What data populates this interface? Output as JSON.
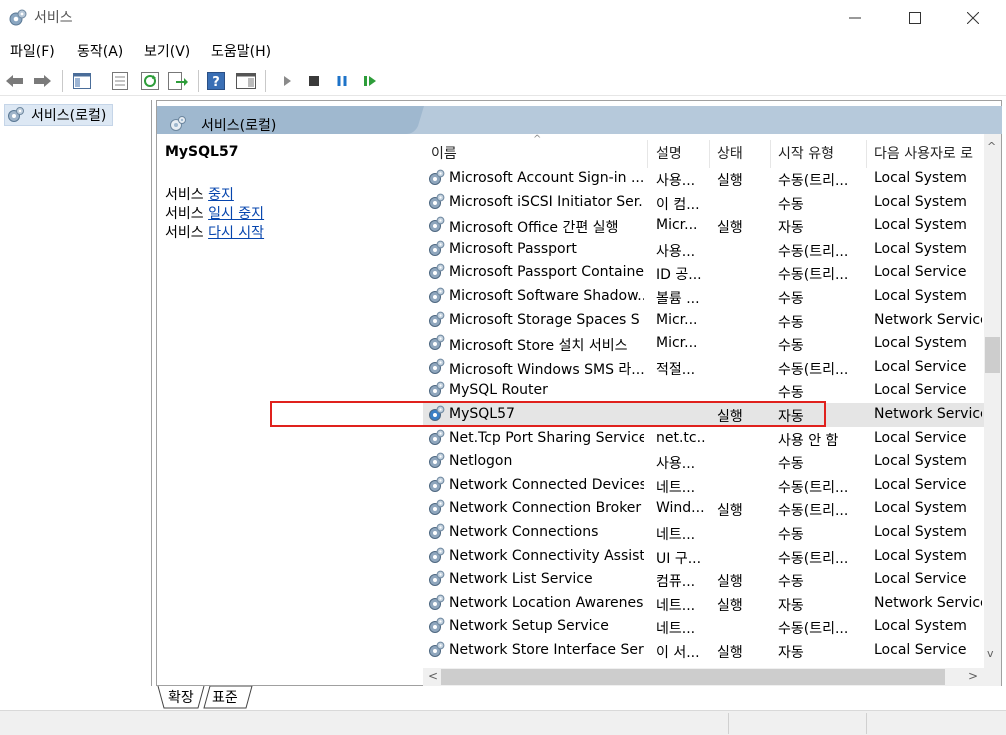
{
  "window": {
    "title": "서비스",
    "icon": "gear-icon"
  },
  "menu": [
    "파일(F)",
    "동작(A)",
    "보기(V)",
    "도움말(H)"
  ],
  "toolbar_icons": [
    "back-arrow-icon",
    "forward-arrow-icon",
    "show-hide-console-tree-icon",
    "properties-icon",
    "refresh-icon",
    "export-list-icon",
    "help-icon",
    "show-hide-action-pane-icon",
    "start-service-icon",
    "stop-service-icon",
    "pause-service-icon",
    "restart-service-icon"
  ],
  "tree": {
    "root_label": "서비스(로컬)"
  },
  "panel": {
    "header_title": "서비스(로컬)",
    "selected_name": "MySQL57",
    "action_prefix": "서비스",
    "actions": [
      "중지",
      "일시 중지",
      "다시 시작"
    ]
  },
  "columns": [
    "이름",
    "설명",
    "상태",
    "시작 유형",
    "다음 사용자로 로"
  ],
  "services": [
    {
      "name": "Microsoft Account Sign-in ...",
      "desc": "사용...",
      "status": "실행",
      "startup": "수동(트리...",
      "logon": "Local System"
    },
    {
      "name": "Microsoft iSCSI Initiator Ser...",
      "desc": "이 컴...",
      "status": "",
      "startup": "수동",
      "logon": "Local System"
    },
    {
      "name": "Microsoft Office 간편 실행",
      "desc": "Micr...",
      "status": "실행",
      "startup": "자동",
      "logon": "Local System"
    },
    {
      "name": "Microsoft Passport",
      "desc": "사용...",
      "status": "",
      "startup": "수동(트리...",
      "logon": "Local System"
    },
    {
      "name": "Microsoft Passport Container",
      "desc": "ID 공...",
      "status": "",
      "startup": "수동(트리...",
      "logon": "Local Service"
    },
    {
      "name": "Microsoft Software Shadow...",
      "desc": "볼륨 ...",
      "status": "",
      "startup": "수동",
      "logon": "Local System"
    },
    {
      "name": "Microsoft Storage Spaces S",
      "desc": "Micr...",
      "status": "",
      "startup": "수동",
      "logon": "Network Service"
    },
    {
      "name": "Microsoft Store 설치 서비스",
      "desc": "Micr...",
      "status": "",
      "startup": "수동",
      "logon": "Local System"
    },
    {
      "name": "Microsoft Windows SMS 라...",
      "desc": "적절...",
      "status": "",
      "startup": "수동(트리...",
      "logon": "Local Service"
    },
    {
      "name": "MySQL Router",
      "desc": "",
      "status": "",
      "startup": "수동",
      "logon": "Local Service"
    },
    {
      "name": "MySQL57",
      "desc": "",
      "status": "실행",
      "startup": "자동",
      "logon": "Network Service",
      "selected": true
    },
    {
      "name": "Net.Tcp Port Sharing Service",
      "desc": "net.tc...",
      "status": "",
      "startup": "사용 안 함",
      "logon": "Local Service"
    },
    {
      "name": "Netlogon",
      "desc": "사용...",
      "status": "",
      "startup": "수동",
      "logon": "Local System"
    },
    {
      "name": "Network Connected Devices...",
      "desc": "네트...",
      "status": "",
      "startup": "수동(트리...",
      "logon": "Local Service"
    },
    {
      "name": "Network Connection Broker",
      "desc": "Wind...",
      "status": "실행",
      "startup": "수동(트리...",
      "logon": "Local System"
    },
    {
      "name": "Network Connections",
      "desc": "네트...",
      "status": "",
      "startup": "수동",
      "logon": "Local System"
    },
    {
      "name": "Network Connectivity Assist",
      "desc": "UI 구...",
      "status": "",
      "startup": "수동(트리...",
      "logon": "Local System"
    },
    {
      "name": "Network List Service",
      "desc": "컴퓨...",
      "status": "실행",
      "startup": "수동",
      "logon": "Local Service"
    },
    {
      "name": "Network Location Awareness",
      "desc": "네트...",
      "status": "실행",
      "startup": "자동",
      "logon": "Network Service"
    },
    {
      "name": "Network Setup Service",
      "desc": "네트...",
      "status": "",
      "startup": "수동(트리...",
      "logon": "Local System"
    },
    {
      "name": "Network Store Interface Ser...",
      "desc": "이 서...",
      "status": "실행",
      "startup": "자동",
      "logon": "Local Service"
    }
  ],
  "bottom_tabs": [
    "확장",
    "표준"
  ],
  "colors": {
    "selection_outline": "#e0211d",
    "header_band": "#9fb8cf",
    "link": "#0645ad"
  }
}
